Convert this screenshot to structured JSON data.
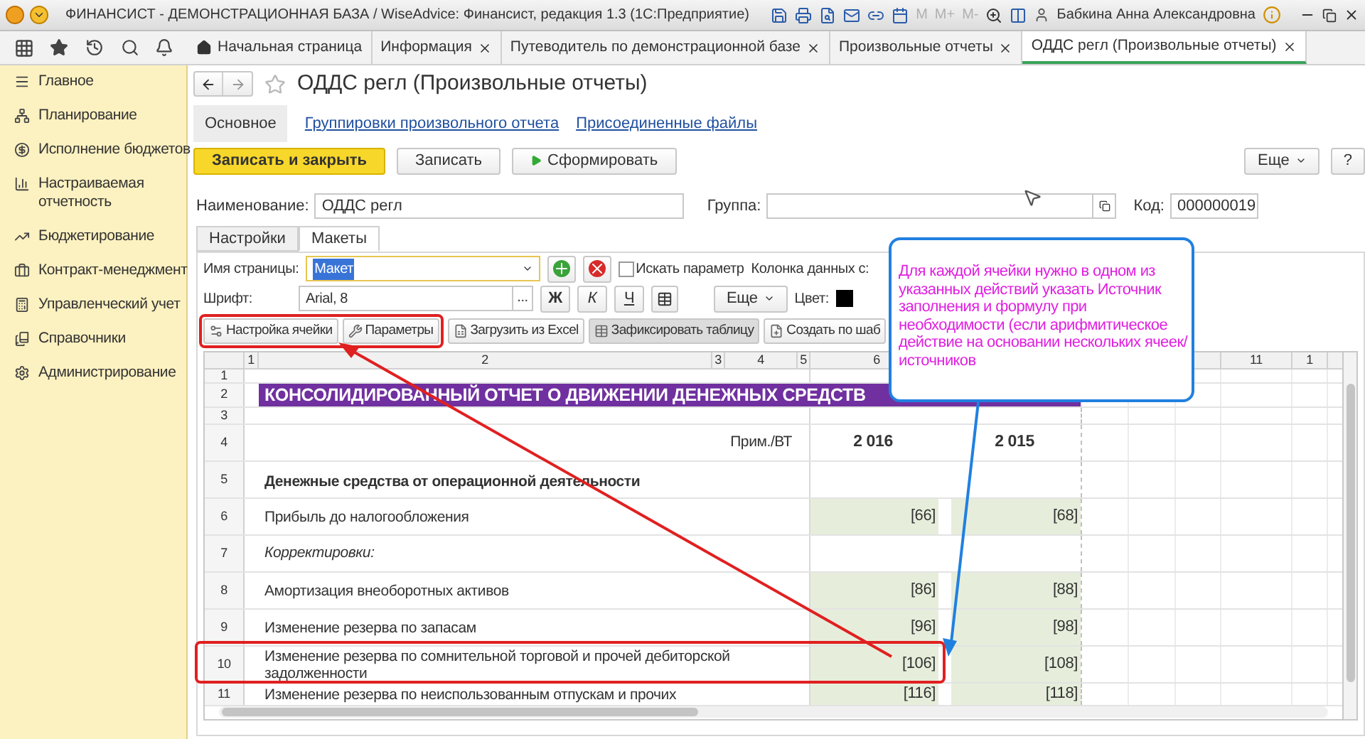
{
  "window": {
    "title": "ФИНАНСИСТ - ДЕМОНСТРАЦИОННАЯ БАЗА / WiseAdvice: Финансист, редакция 1.3  (1С:Предприятие)",
    "memory_buttons": [
      "M",
      "M+",
      "M-"
    ],
    "user": "Бабкина Анна Александровна"
  },
  "tabs": [
    {
      "label": "Начальная страница",
      "closable": false,
      "selected": false
    },
    {
      "label": "Информация",
      "closable": true,
      "selected": false
    },
    {
      "label": "Путеводитель по демонстрационной базе",
      "closable": true,
      "selected": false
    },
    {
      "label": "Произвольные отчеты",
      "closable": true,
      "selected": false
    },
    {
      "label": "ОДДС регл (Произвольные отчеты)",
      "closable": true,
      "selected": true
    }
  ],
  "sidebar": {
    "items": [
      {
        "label": "Главное"
      },
      {
        "label": "Планирование"
      },
      {
        "label": "Исполнение бюджетов"
      },
      {
        "label": "Настраиваемая отчетность"
      },
      {
        "label": "Бюджетирование"
      },
      {
        "label": "Контракт-менеджмент"
      },
      {
        "label": "Управленческий учет"
      },
      {
        "label": "Справочники"
      },
      {
        "label": "Администрирование"
      }
    ]
  },
  "form": {
    "title": "ОДДС регл (Произвольные отчеты)",
    "sections": [
      {
        "label": "Основное",
        "selected": true
      },
      {
        "label": "Группировки произвольного отчета",
        "selected": false
      },
      {
        "label": "Присоединенные файлы",
        "selected": false
      }
    ],
    "buttons": [
      {
        "label": "Записать и закрыть",
        "kind": "primary"
      },
      {
        "label": "Записать",
        "kind": "plain"
      },
      {
        "label": "Сформировать",
        "kind": "run"
      }
    ],
    "more": "Еще",
    "help": "?",
    "name": {
      "label": "Наименование:",
      "value": "ОДДС регл"
    },
    "group": {
      "label": "Группа:"
    },
    "code": {
      "label": "Код:",
      "value": "000000019"
    },
    "tabs": [
      {
        "label": "Настройки",
        "selected": false
      },
      {
        "label": "Макеты",
        "selected": true
      }
    ],
    "page_name": {
      "label": "Имя страницы:",
      "value": "Макет"
    },
    "search_param": {
      "label": "Искать параметр",
      "checked": false
    },
    "data_column": {
      "label": "Колонка данных с:"
    },
    "font": {
      "label": "Шрифт:",
      "value": "Arial, 8",
      "choose": "..."
    },
    "style_buttons": [
      "Ж",
      "К",
      "Ч"
    ],
    "format_more": "Еще",
    "color": {
      "label": "Цвет:",
      "color": "#000000"
    },
    "toolbar": [
      {
        "label": "Настройка ячейки",
        "pressed": false
      },
      {
        "label": "Параметры",
        "pressed": false
      },
      {
        "label": "Загрузить из Excel",
        "pressed": false
      },
      {
        "label": "Зафиксировать таблицу",
        "pressed": true
      },
      {
        "label": "Создать по шаб",
        "pressed": false
      }
    ]
  },
  "sheet": {
    "column_headers": [
      "1",
      "2",
      "3",
      "4",
      "5",
      "6",
      "11",
      "1"
    ],
    "rows": [
      {
        "number": "1",
        "kind": "blank"
      },
      {
        "number": "2",
        "kind": "title",
        "label": "КОНСОЛИДИРОВАННЫЙ ОТЧЕТ О ДВИЖЕНИИ ДЕНЕЖНЫХ СРЕДСТВ"
      },
      {
        "number": "3",
        "kind": "blank"
      },
      {
        "number": "4",
        "kind": "header",
        "note": "Прим./ВТ",
        "values": [
          "2 016",
          "2 015"
        ]
      },
      {
        "number": "5",
        "kind": "section",
        "label": "Денежные средства от операционной деятельности"
      },
      {
        "number": "6",
        "kind": "item",
        "label": "Прибыль до налогообложения",
        "values": [
          "[66]",
          "[68]"
        ]
      },
      {
        "number": "7",
        "kind": "italic",
        "label": "Корректировки:"
      },
      {
        "number": "8",
        "kind": "item",
        "label": "Амортизация внеоборотных активов",
        "values": [
          "[86]",
          "[88]"
        ]
      },
      {
        "number": "9",
        "kind": "item",
        "label": "Изменение резерва по запасам",
        "values": [
          "[96]",
          "[98]"
        ]
      },
      {
        "number": "10",
        "kind": "item",
        "label": "Изменение резерва по сомнительной торговой и прочей дебиторской задолженности",
        "values": [
          "[106]",
          "[108]"
        ]
      },
      {
        "number": "11",
        "kind": "item",
        "label": "Изменение резерва по неиспользованным отпускам и прочих",
        "values": [
          "[116]",
          "[118]"
        ]
      }
    ]
  },
  "callout": {
    "text": "Для каждой ячейки нужно в одном из указанных действий указать Источник заполнения и формулу при необходимости (если арифмитическое действие на основании нескольких ячеек/источников"
  }
}
